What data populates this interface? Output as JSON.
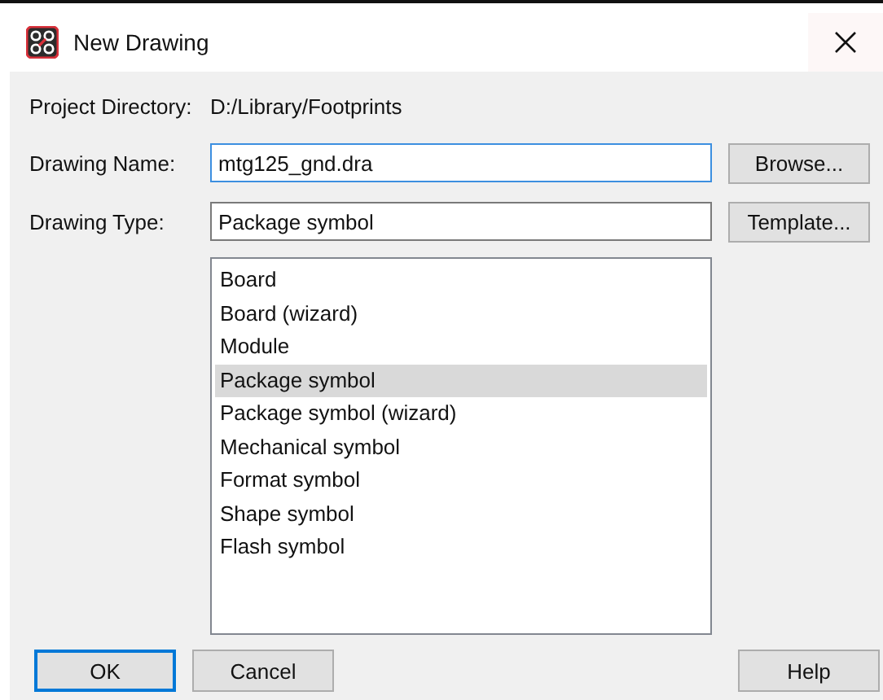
{
  "window": {
    "title": "New Drawing"
  },
  "project_directory": {
    "label": "Project Directory:",
    "value": "D:/Library/Footprints"
  },
  "drawing_name": {
    "label": "Drawing Name:",
    "value": "mtg125_gnd.dra",
    "focused": true
  },
  "drawing_type": {
    "label": "Drawing Type:",
    "value": "Package symbol"
  },
  "browse_button": "Browse...",
  "template_button": "Template...",
  "type_list": [
    {
      "label": "Board",
      "selected": false
    },
    {
      "label": "Board (wizard)",
      "selected": false
    },
    {
      "label": "Module",
      "selected": false
    },
    {
      "label": "Package symbol",
      "selected": true
    },
    {
      "label": "Package symbol (wizard)",
      "selected": false
    },
    {
      "label": "Mechanical symbol",
      "selected": false
    },
    {
      "label": "Format symbol",
      "selected": false
    },
    {
      "label": "Shape symbol",
      "selected": false
    },
    {
      "label": "Flash symbol",
      "selected": false
    }
  ],
  "buttons": [
    {
      "label": "OK",
      "default": true
    },
    {
      "label": "Cancel",
      "default": false
    },
    {
      "label": "Help",
      "default": false
    }
  ]
}
